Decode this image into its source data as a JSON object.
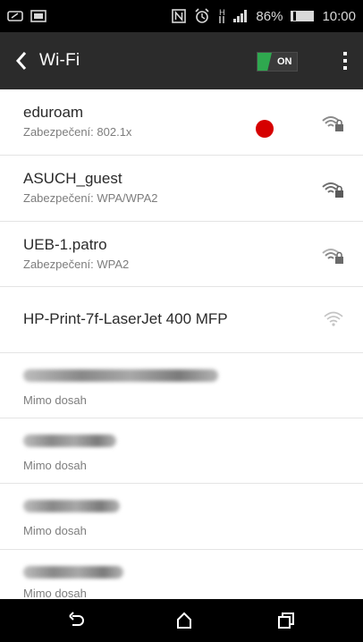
{
  "status_bar": {
    "battery_percent": "86%",
    "time": "10:00",
    "network_letter": "H",
    "icons": [
      "edit-icon",
      "image-icon",
      "nfc-icon",
      "alarm-icon",
      "signal-icon",
      "battery-icon"
    ]
  },
  "header": {
    "title": "Wi-Fi",
    "toggle_label": "ON",
    "toggle_color": "#2fa84f"
  },
  "networks": [
    {
      "name": "eduroam",
      "security": "Zabezpečení: 802.1x",
      "secured": true
    },
    {
      "name": "ASUCH_guest",
      "security": "Zabezpečení: WPA/WPA2",
      "secured": true
    },
    {
      "name": "UEB-1.patro",
      "security": "Zabezpečení: WPA2",
      "secured": true
    },
    {
      "name": "HP-Print-7f-LaserJet 400 MFP",
      "security": "",
      "secured": false
    }
  ],
  "out_of_range": [
    {
      "status": "Mimo dosah"
    },
    {
      "status": "Mimo dosah"
    },
    {
      "status": "Mimo dosah"
    },
    {
      "status": "Mimo dosah"
    }
  ],
  "annotation": {
    "color": "#d60000"
  },
  "nav_bar": {
    "icons": [
      "back-icon",
      "home-icon",
      "recent-apps-icon"
    ]
  }
}
